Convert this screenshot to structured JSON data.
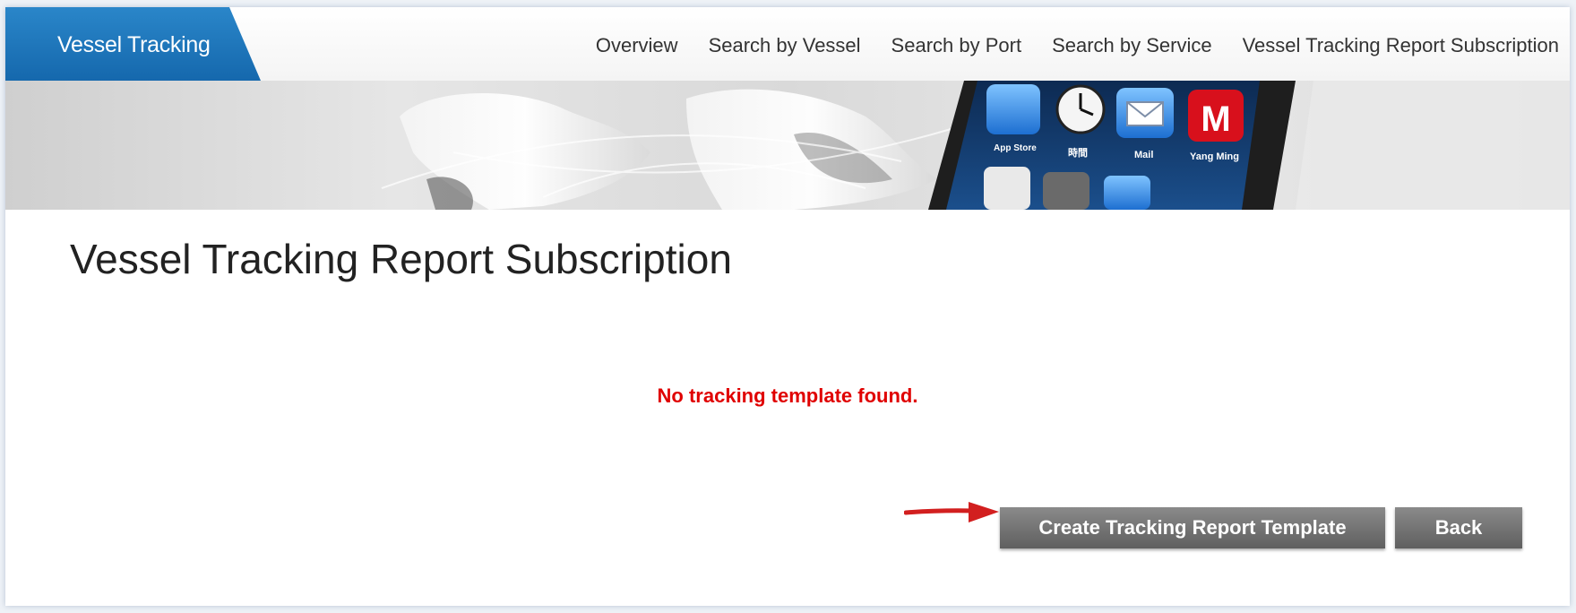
{
  "header": {
    "brand": "Vessel Tracking",
    "nav": [
      {
        "label": "Overview"
      },
      {
        "label": "Search by Vessel"
      },
      {
        "label": "Search by Port"
      },
      {
        "label": "Search by Service"
      },
      {
        "label": "Vessel Tracking Report Subscription"
      }
    ]
  },
  "banner": {
    "apps": [
      "App Store",
      "時間",
      "Mail",
      "Yang Ming"
    ]
  },
  "main": {
    "title": "Vessel Tracking Report Subscription",
    "message": "No tracking template found.",
    "create_button": "Create Tracking Report Template",
    "back_button": "Back"
  },
  "colors": {
    "brand": "#1a73b8",
    "error": "#e00000",
    "button": "#6f6f6f",
    "arrow": "#d21f1f"
  }
}
